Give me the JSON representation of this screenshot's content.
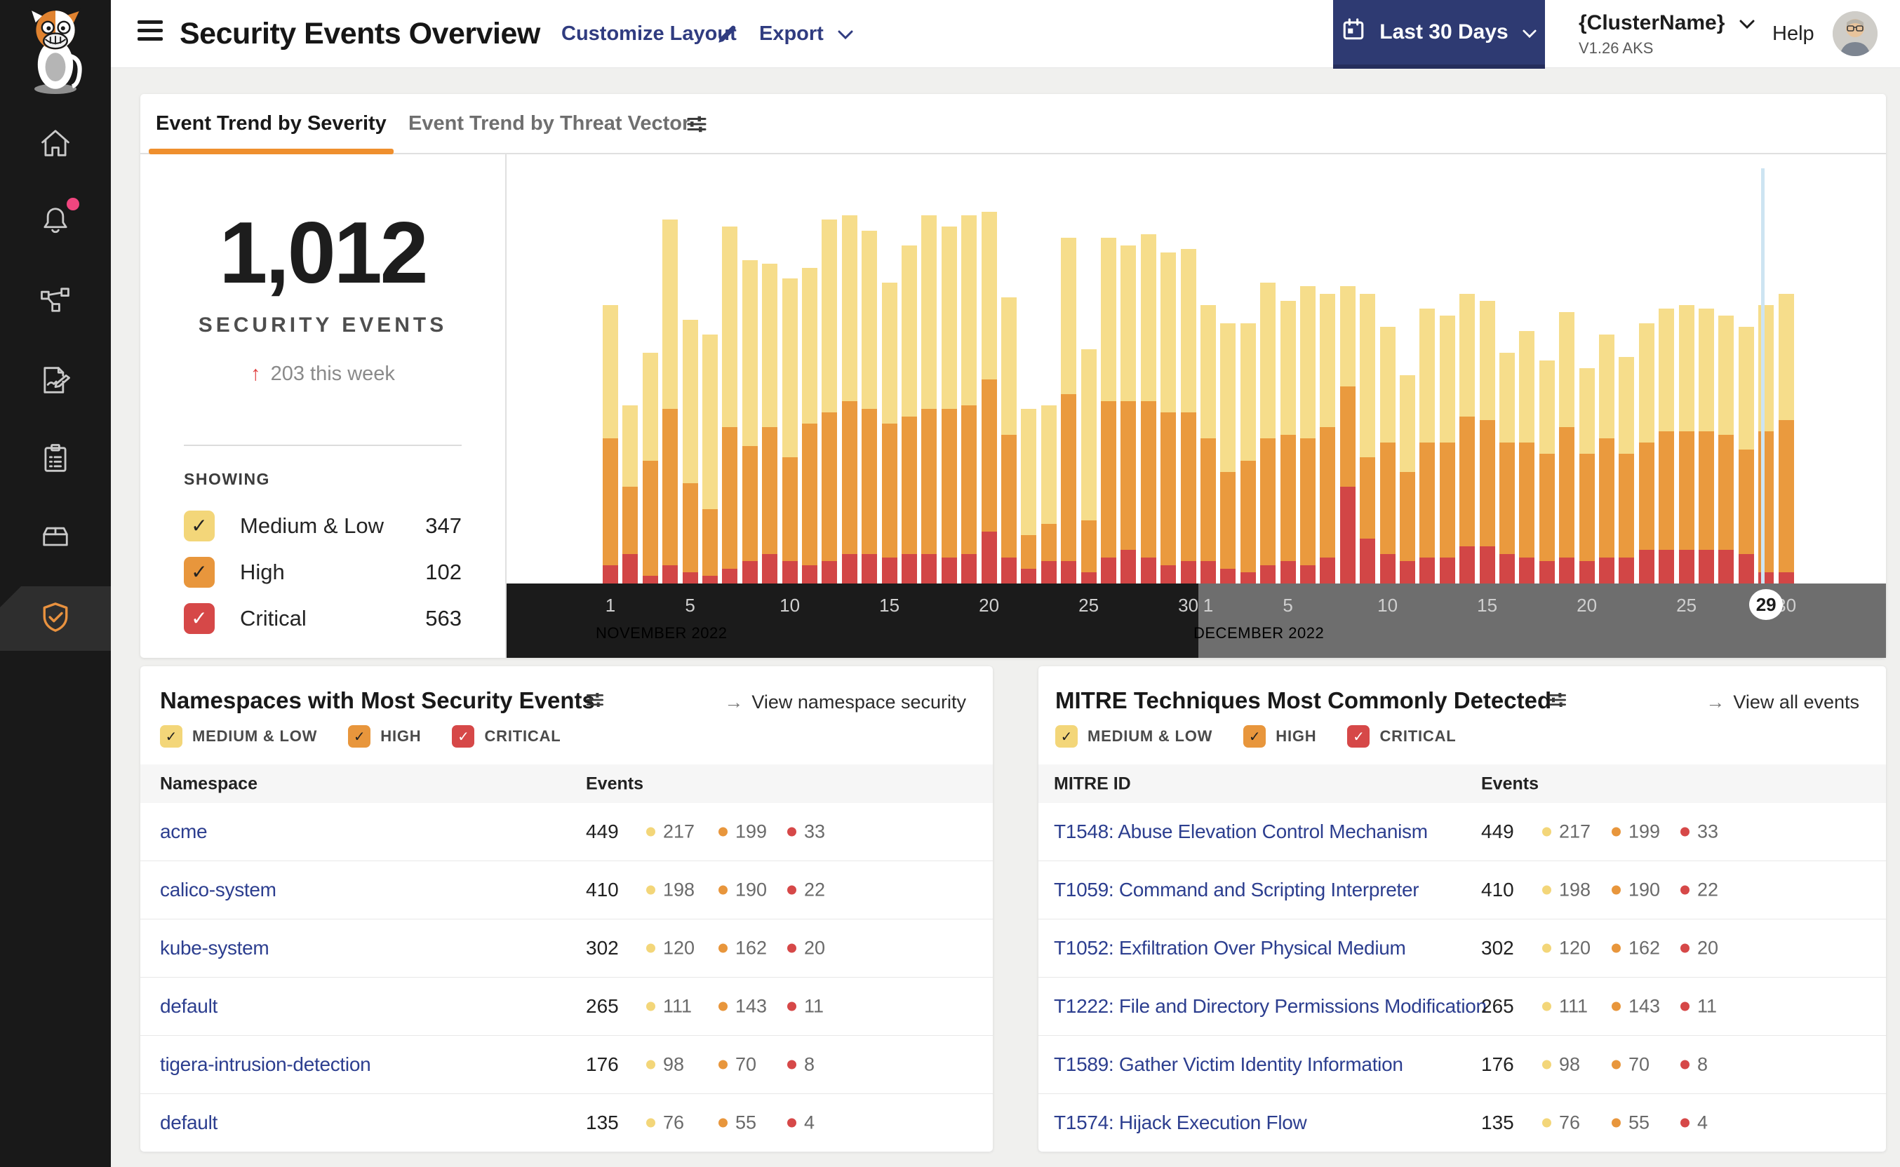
{
  "header": {
    "title": "Security Events Overview",
    "customize_label": "Customize Layout",
    "export_label": "Export",
    "date_range_label": "Last 30 Days",
    "cluster_name": "{ClusterName}",
    "cluster_version": "V1.26 AKS",
    "help_label": "Help"
  },
  "sidebar": {
    "items": [
      "home",
      "alerts",
      "service-graph",
      "policies",
      "compliance",
      "workloads",
      "threat-defense"
    ],
    "active_item": "threat-defense",
    "alert_dot_color": "#f1467f",
    "active_accent": "#e9923f"
  },
  "tabs": {
    "active": "Event Trend by Severity",
    "inactive": "Event Trend by Threat Vector",
    "active_underline_color": "#ef8f2e"
  },
  "stat": {
    "value": "1,012",
    "label": "SECURITY EVENTS",
    "delta_arrow": "↑",
    "delta_text": "203 this week",
    "showing_label": "SHOWING",
    "legend": [
      {
        "label": "Medium & Low",
        "count": "347",
        "sev": "medium_low"
      },
      {
        "label": "High",
        "count": "102",
        "sev": "high"
      },
      {
        "label": "Critical",
        "count": "563",
        "sev": "critical"
      }
    ]
  },
  "severities": [
    {
      "id": "medium_low",
      "label": "MEDIUM & LOW",
      "box": "#f3d679",
      "check": "#222222"
    },
    {
      "id": "high",
      "label": "HIGH",
      "box": "#e8963c",
      "check": "#222222"
    },
    {
      "id": "critical",
      "label": "CRITICAL",
      "box": "#d64848",
      "check": "#ffffff"
    }
  ],
  "chart_data": {
    "type": "bar",
    "stacked": true,
    "note": "Daily stacked security events, values are relative units (percent of tallest bar), stack order bottom-to-top: critical, high, medium_low",
    "colors": {
      "critical": "#d24646",
      "high": "#ea9a3e",
      "medium_low": "#f6dd8b"
    },
    "series": [
      {
        "id": "critical",
        "color": "#d24646",
        "values": [
          5,
          8,
          2,
          5,
          3,
          2,
          4,
          6,
          8,
          6,
          5,
          6,
          8,
          8,
          7,
          8,
          8,
          7,
          8,
          14,
          7,
          4,
          6,
          6,
          3,
          7,
          9,
          7,
          5,
          6,
          6,
          4,
          3,
          5,
          6,
          5,
          7,
          26,
          12,
          8,
          6,
          7,
          7,
          10,
          10,
          8,
          7,
          6,
          7,
          6,
          7,
          7,
          9,
          9,
          9,
          9,
          9,
          8,
          3,
          3
        ]
      },
      {
        "id": "high",
        "color": "#ea9a3e",
        "values": [
          34,
          18,
          31,
          42,
          24,
          18,
          38,
          31,
          34,
          28,
          38,
          40,
          41,
          39,
          36,
          37,
          39,
          40,
          40,
          41,
          33,
          9,
          10,
          45,
          14,
          42,
          40,
          42,
          41,
          40,
          33,
          26,
          30,
          34,
          34,
          34,
          35,
          27,
          22,
          30,
          24,
          31,
          31,
          35,
          34,
          30,
          31,
          29,
          35,
          29,
          32,
          28,
          29,
          32,
          32,
          32,
          31,
          28,
          38,
          41
        ]
      },
      {
        "id": "medium_low",
        "color": "#f6dd8b",
        "values": [
          36,
          22,
          29,
          51,
          44,
          47,
          54,
          50,
          44,
          48,
          42,
          52,
          50,
          48,
          38,
          46,
          52,
          49,
          51,
          45,
          37,
          34,
          32,
          42,
          46,
          44,
          42,
          45,
          43,
          44,
          36,
          40,
          37,
          42,
          36,
          41,
          36,
          27,
          44,
          31,
          26,
          36,
          34,
          33,
          32,
          24,
          30,
          25,
          31,
          23,
          28,
          26,
          32,
          33,
          34,
          33,
          32,
          33,
          34,
          34
        ]
      }
    ],
    "axis": {
      "months": [
        {
          "label": "NOVEMBER 2022",
          "days": 30,
          "ticks": [
            1,
            5,
            10,
            15,
            20,
            25,
            30
          ],
          "bg": "#1b1b1b"
        },
        {
          "label": "DECEMBER 2022",
          "days": 30,
          "ticks": [
            1,
            5,
            10,
            15,
            20,
            25,
            30
          ],
          "bg": "#6e6e6e"
        }
      ],
      "pill": {
        "month_index": 1,
        "day": 29
      },
      "marker": {
        "month_index": 1,
        "day": 29,
        "color": "#cde4f2"
      }
    },
    "title": "Event Trend by Severity",
    "xlabel": "",
    "ylabel": ""
  },
  "panels": [
    {
      "title": "Namespaces with Most Security Events",
      "link": "View namespace security",
      "col_name": "Namespace",
      "col_events": "Events",
      "rows": [
        {
          "name": "acme",
          "total": "449",
          "counts": {
            "medium_low": "217",
            "high": "199",
            "critical": "33"
          }
        },
        {
          "name": "calico-system",
          "total": "410",
          "counts": {
            "medium_low": "198",
            "high": "190",
            "critical": "22"
          }
        },
        {
          "name": "kube-system",
          "total": "302",
          "counts": {
            "medium_low": "120",
            "high": "162",
            "critical": "20"
          }
        },
        {
          "name": "default",
          "total": "265",
          "counts": {
            "medium_low": "111",
            "high": "143",
            "critical": "11"
          }
        },
        {
          "name": "tigera-intrusion-detection",
          "total": "176",
          "counts": {
            "medium_low": "98",
            "high": "70",
            "critical": "8"
          }
        },
        {
          "name": "default",
          "total": "135",
          "counts": {
            "medium_low": "76",
            "high": "55",
            "critical": "4"
          }
        }
      ]
    },
    {
      "title": "MITRE Techniques Most Commonly Detected",
      "link": "View all events",
      "col_name": "MITRE ID",
      "col_events": "Events",
      "rows": [
        {
          "name": "T1548: Abuse Elevation Control Mechanism",
          "total": "449",
          "counts": {
            "medium_low": "217",
            "high": "199",
            "critical": "33"
          }
        },
        {
          "name": "T1059: Command and Scripting Interpreter",
          "total": "410",
          "counts": {
            "medium_low": "198",
            "high": "190",
            "critical": "22"
          }
        },
        {
          "name": "T1052: Exfiltration Over Physical Medium",
          "total": "302",
          "counts": {
            "medium_low": "120",
            "high": "162",
            "critical": "20"
          }
        },
        {
          "name": "T1222: File and Directory Permissions Modification",
          "total": "265",
          "counts": {
            "medium_low": "111",
            "high": "143",
            "critical": "11"
          }
        },
        {
          "name": "T1589: Gather Victim Identity Information",
          "total": "176",
          "counts": {
            "medium_low": "98",
            "high": "70",
            "critical": "8"
          }
        },
        {
          "name": "T1574: Hijack Execution Flow",
          "total": "135",
          "counts": {
            "medium_low": "76",
            "high": "55",
            "critical": "4"
          }
        }
      ]
    }
  ]
}
